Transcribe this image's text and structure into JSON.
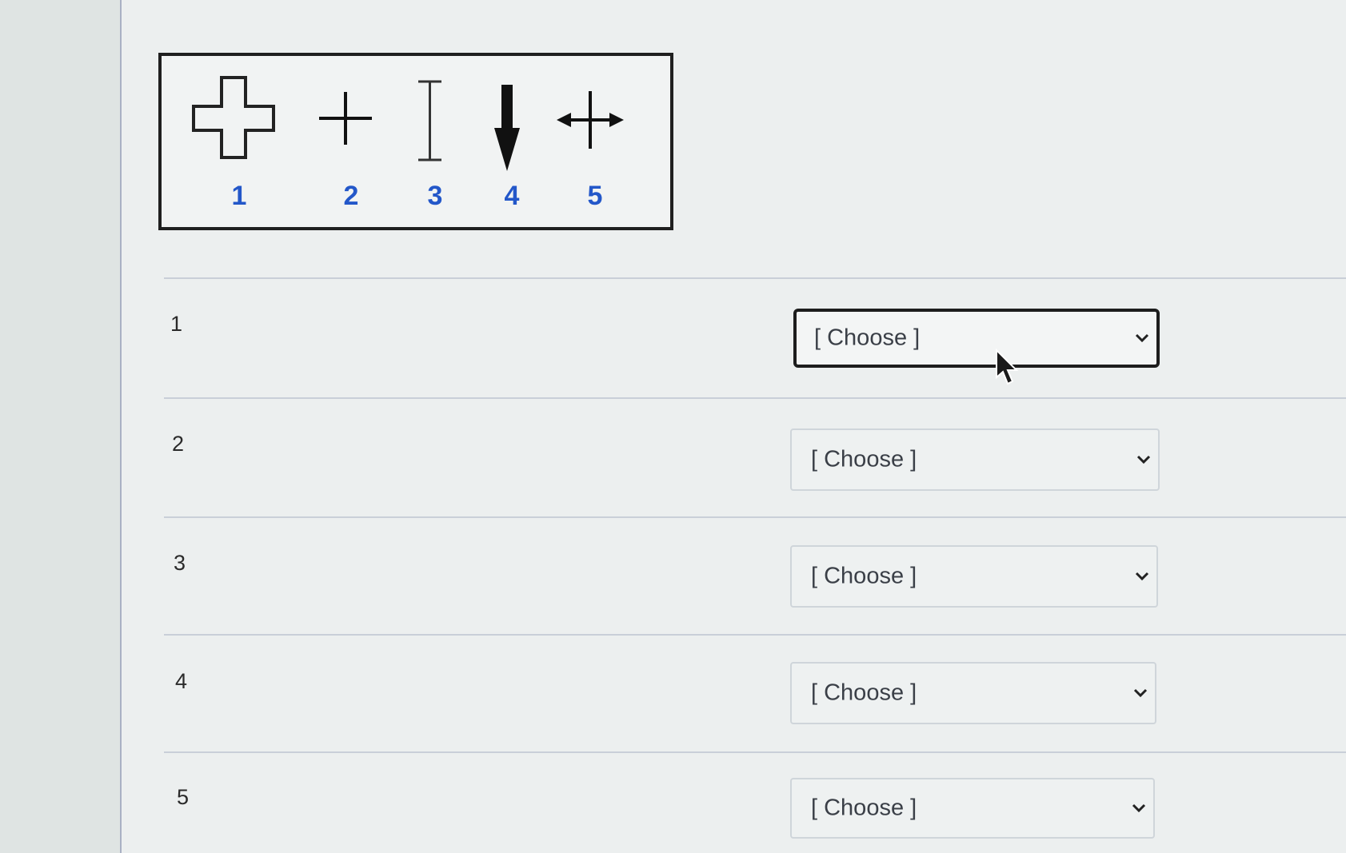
{
  "cursor_legend": {
    "items": [
      {
        "number": "1",
        "icon": "hollow-cross-icon"
      },
      {
        "number": "2",
        "icon": "crosshair-plus-icon"
      },
      {
        "number": "3",
        "icon": "ibeam-text-cursor-icon"
      },
      {
        "number": "4",
        "icon": "down-arrow-icon"
      },
      {
        "number": "5",
        "icon": "horizontal-resize-icon"
      }
    ]
  },
  "rows": [
    {
      "number": "1",
      "select_value": "[ Choose ]",
      "focused": true
    },
    {
      "number": "2",
      "select_value": "[ Choose ]",
      "focused": false
    },
    {
      "number": "3",
      "select_value": "[ Choose ]",
      "focused": false
    },
    {
      "number": "4",
      "select_value": "[ Choose ]",
      "focused": false
    },
    {
      "number": "5",
      "select_value": "[ Choose ]",
      "focused": false
    }
  ],
  "colors": {
    "legend_number": "#2357c9",
    "border_dark": "#1f1f1f",
    "background": "#ecefef"
  }
}
